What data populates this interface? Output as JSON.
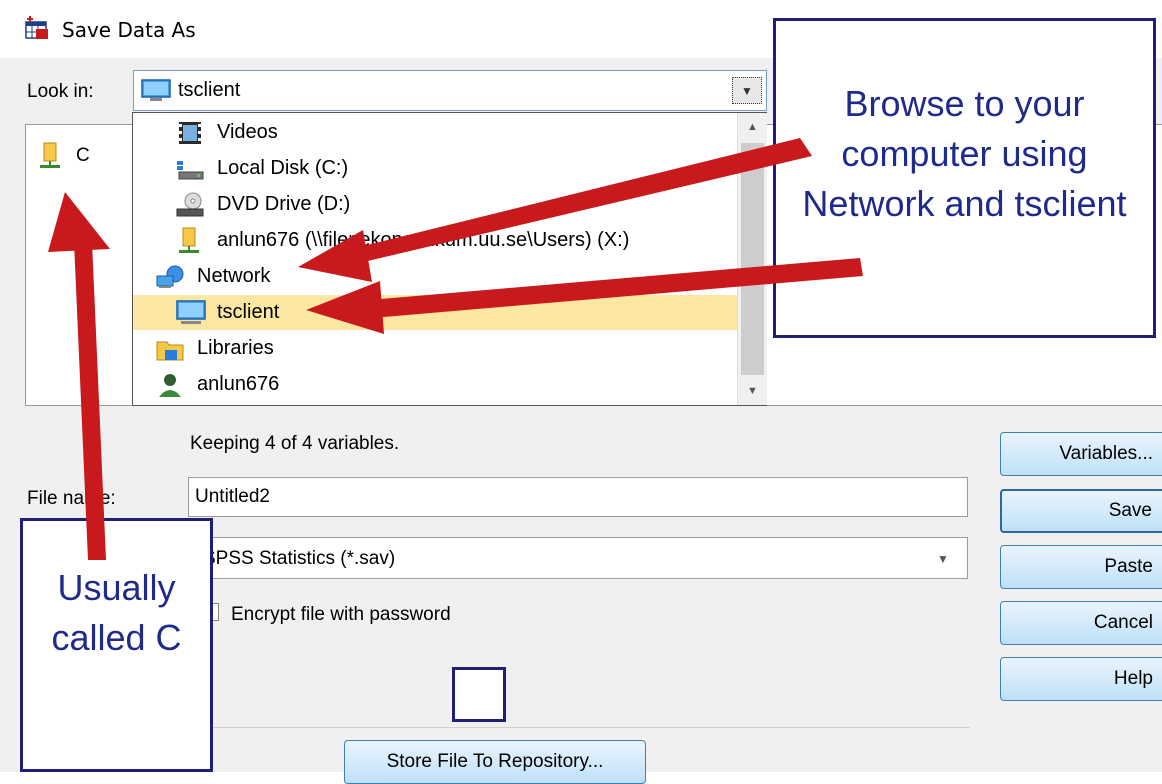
{
  "window": {
    "title": "Save Data As"
  },
  "look_in": {
    "label": "Look in:",
    "value": "tsclient"
  },
  "file_list": {
    "items": [
      {
        "label": "C",
        "icon": "network-drive-icon"
      }
    ]
  },
  "dropdown": {
    "items": [
      {
        "label": "Videos",
        "icon": "videos-folder-icon"
      },
      {
        "label": "Local Disk (C:)",
        "icon": "local-disk-icon"
      },
      {
        "label": "DVD Drive (D:)",
        "icon": "dvd-drive-icon"
      },
      {
        "label": "anlun676 (\\\\filer.ekonomikum.uu.se\\Users) (X:)",
        "icon": "network-drive-icon"
      },
      {
        "label": "Network",
        "icon": "network-icon"
      },
      {
        "label": "tsclient",
        "icon": "computer-icon",
        "selected": true
      },
      {
        "label": "Libraries",
        "icon": "libraries-icon"
      },
      {
        "label": "anlun676",
        "icon": "user-icon"
      }
    ]
  },
  "status": {
    "keeping": "Keeping 4 of 4 variables."
  },
  "file_name": {
    "label": "File name:",
    "value": "Untitled2"
  },
  "save_as_type": {
    "value": "SPSS Statistics (*.sav)"
  },
  "encrypt": {
    "label": "Encrypt file with password",
    "checked": false
  },
  "buttons": {
    "variables": "Variables...",
    "save": "Save",
    "paste": "Paste",
    "cancel": "Cancel",
    "help": "Help",
    "store": "Store File To Repository..."
  },
  "callouts": {
    "browse": "Browse to your computer using Network and tsclient",
    "usually": "Usually called C"
  },
  "colors": {
    "arrow": "#c8191c",
    "callout_text": "#1f2a8a",
    "callout_border": "#1f1f7a",
    "selected_row": "#fbe6a2"
  }
}
